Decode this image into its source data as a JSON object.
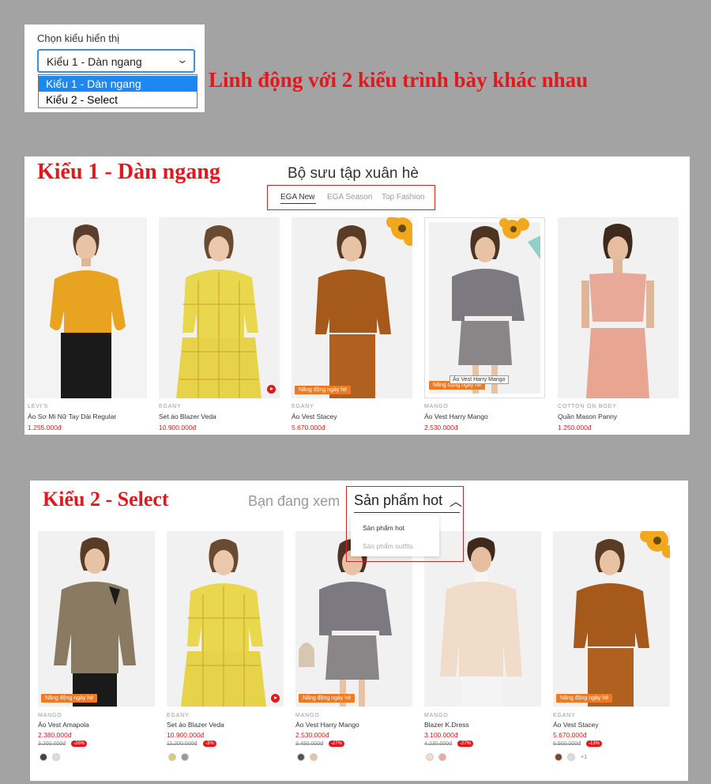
{
  "top": {
    "select_label": "Chọn kiểu hiển thị",
    "select_value": "Kiểu 1 - Dàn ngang",
    "options": [
      "Kiểu 1 - Dàn ngang",
      "Kiểu 2 - Select"
    ],
    "heading": "Linh động với 2 kiểu trình bày khác nhau"
  },
  "panel1": {
    "tag": "Kiểu 1 - Dàn ngang",
    "title": "Bộ sưu tập xuân hè",
    "tabs": [
      "EGA New",
      "EGA Season",
      "Top Fashion"
    ],
    "products": [
      {
        "brand": "LEVI'S",
        "name": "Áo Sơ Mi Nữ Tay Dài Regular",
        "price": "1.255.000đ"
      },
      {
        "brand": "EGANY",
        "name": "Set áo Blazer Veda",
        "price": "10.900.000đ"
      },
      {
        "brand": "EGANY",
        "name": "Áo Vest Stacey",
        "price": "5.670.000đ",
        "badge": "Nâng động ngày hè"
      },
      {
        "brand": "MANGO",
        "name": "Áo Vest Harry Mango",
        "price": "2.530.000đ",
        "badge": "Nâng động ngày hè",
        "tooltip": "Áo Vest Harry Mango"
      },
      {
        "brand": "COTTON ON BODY",
        "name": "Quần Mason Panny",
        "price": "1.250.000đ"
      }
    ]
  },
  "panel2": {
    "tag": "Kiểu 2 - Select",
    "viewing_label": "Bạn đang xem",
    "selected": "Sản phẩm hot",
    "dropdown": [
      "Sản phẩm hot",
      "Sản phẩm outfits"
    ],
    "products": [
      {
        "brand": "MANGO",
        "name": "Áo Vest Amapola",
        "price": "2.380.000đ",
        "old_price": "3.200.000đ",
        "discount": "-26%",
        "badge": "Nâng động ngày hè"
      },
      {
        "brand": "EGANY",
        "name": "Set áo Blazer Veda",
        "price": "10.900.000đ",
        "old_price": "11.200.000đ",
        "discount": "-3%"
      },
      {
        "brand": "MANGO",
        "name": "Áo Vest Harry Mango",
        "price": "2.530.000đ",
        "old_price": "3.450.000đ",
        "discount": "-27%",
        "badge": "Nâng động ngày hè"
      },
      {
        "brand": "MANGO",
        "name": "Blazer K.Dress",
        "price": "3.100.000đ",
        "old_price": "4.230.000đ",
        "discount": "-27%"
      },
      {
        "brand": "EGANY",
        "name": "Áo Vest Stacey",
        "price": "5.670.000đ",
        "old_price": "6.500.000đ",
        "discount": "-13%",
        "badge": "Nâng động ngày hè",
        "more_colors": "+1"
      }
    ]
  },
  "colors": {
    "accent_red": "#e2181d",
    "badge_orange": "#f07a24",
    "select_blue": "#1e87f0"
  }
}
